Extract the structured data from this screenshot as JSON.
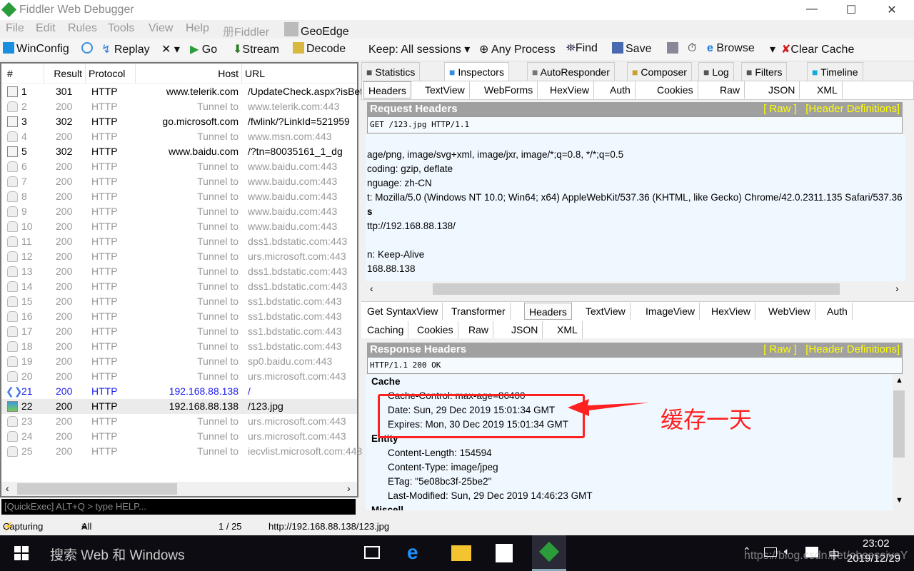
{
  "window": {
    "title": "Fiddler Web Debugger",
    "min": "—",
    "max": "☐",
    "close": "✕"
  },
  "menu": [
    "File",
    "Edit",
    "Rules",
    "Tools",
    "View",
    "Help",
    "Fiddler",
    "GeoEdge"
  ],
  "toolbar": {
    "winconfig": "WinConfig",
    "replay": "Replay",
    "remove": "✕ ▾",
    "go": "Go",
    "stream": "Stream",
    "decode": "Decode",
    "keep": "Keep: All sessions ▾",
    "process": "Any Process",
    "find": "Find",
    "save": "Save",
    "browse": "Browse",
    "browse_arrow": "▾",
    "clear_cache": "Clear Cache"
  },
  "sessions": {
    "columns": [
      "#",
      "Result",
      "Protocol",
      "Host",
      "URL"
    ],
    "rows": [
      {
        "id": "1",
        "result": "301",
        "protocol": "HTTP",
        "host": "www.telerik.com",
        "url": "/UpdateCheck.aspx?isBet",
        "type": "redirect"
      },
      {
        "id": "2",
        "result": "200",
        "protocol": "HTTP",
        "host": "Tunnel to",
        "url": "www.telerik.com:443",
        "type": "tunnel"
      },
      {
        "id": "3",
        "result": "302",
        "protocol": "HTTP",
        "host": "go.microsoft.com",
        "url": "/fwlink/?LinkId=521959",
        "type": "redirect"
      },
      {
        "id": "4",
        "result": "200",
        "protocol": "HTTP",
        "host": "Tunnel to",
        "url": "www.msn.com:443",
        "type": "tunnel"
      },
      {
        "id": "5",
        "result": "302",
        "protocol": "HTTP",
        "host": "www.baidu.com",
        "url": "/?tn=80035161_1_dg",
        "type": "redirect"
      },
      {
        "id": "6",
        "result": "200",
        "protocol": "HTTP",
        "host": "Tunnel to",
        "url": "www.baidu.com:443",
        "type": "tunnel"
      },
      {
        "id": "7",
        "result": "200",
        "protocol": "HTTP",
        "host": "Tunnel to",
        "url": "www.baidu.com:443",
        "type": "tunnel"
      },
      {
        "id": "8",
        "result": "200",
        "protocol": "HTTP",
        "host": "Tunnel to",
        "url": "www.baidu.com:443",
        "type": "tunnel"
      },
      {
        "id": "9",
        "result": "200",
        "protocol": "HTTP",
        "host": "Tunnel to",
        "url": "www.baidu.com:443",
        "type": "tunnel"
      },
      {
        "id": "10",
        "result": "200",
        "protocol": "HTTP",
        "host": "Tunnel to",
        "url": "www.baidu.com:443",
        "type": "tunnel"
      },
      {
        "id": "11",
        "result": "200",
        "protocol": "HTTP",
        "host": "Tunnel to",
        "url": "dss1.bdstatic.com:443",
        "type": "tunnel"
      },
      {
        "id": "12",
        "result": "200",
        "protocol": "HTTP",
        "host": "Tunnel to",
        "url": "urs.microsoft.com:443",
        "type": "tunnel"
      },
      {
        "id": "13",
        "result": "200",
        "protocol": "HTTP",
        "host": "Tunnel to",
        "url": "dss1.bdstatic.com:443",
        "type": "tunnel"
      },
      {
        "id": "14",
        "result": "200",
        "protocol": "HTTP",
        "host": "Tunnel to",
        "url": "dss1.bdstatic.com:443",
        "type": "tunnel"
      },
      {
        "id": "15",
        "result": "200",
        "protocol": "HTTP",
        "host": "Tunnel to",
        "url": "ss1.bdstatic.com:443",
        "type": "tunnel"
      },
      {
        "id": "16",
        "result": "200",
        "protocol": "HTTP",
        "host": "Tunnel to",
        "url": "ss1.bdstatic.com:443",
        "type": "tunnel"
      },
      {
        "id": "17",
        "result": "200",
        "protocol": "HTTP",
        "host": "Tunnel to",
        "url": "ss1.bdstatic.com:443",
        "type": "tunnel"
      },
      {
        "id": "18",
        "result": "200",
        "protocol": "HTTP",
        "host": "Tunnel to",
        "url": "ss1.bdstatic.com:443",
        "type": "tunnel"
      },
      {
        "id": "19",
        "result": "200",
        "protocol": "HTTP",
        "host": "Tunnel to",
        "url": "sp0.baidu.com:443",
        "type": "tunnel"
      },
      {
        "id": "20",
        "result": "200",
        "protocol": "HTTP",
        "host": "Tunnel to",
        "url": "urs.microsoft.com:443",
        "type": "tunnel"
      },
      {
        "id": "21",
        "result": "200",
        "protocol": "HTTP",
        "host": "192.168.88.138",
        "url": "/",
        "type": "html"
      },
      {
        "id": "22",
        "result": "200",
        "protocol": "HTTP",
        "host": "192.168.88.138",
        "url": "/123.jpg",
        "type": "image",
        "selected": true
      },
      {
        "id": "23",
        "result": "200",
        "protocol": "HTTP",
        "host": "Tunnel to",
        "url": "urs.microsoft.com:443",
        "type": "tunnel"
      },
      {
        "id": "24",
        "result": "200",
        "protocol": "HTTP",
        "host": "Tunnel to",
        "url": "urs.microsoft.com:443",
        "type": "tunnel"
      },
      {
        "id": "25",
        "result": "200",
        "protocol": "HTTP",
        "host": "Tunnel to",
        "url": "iecvlist.microsoft.com:443",
        "type": "tunnel"
      }
    ]
  },
  "quickexec": {
    "placeholder": "[QuickExec] ALT+Q > type HELP..."
  },
  "status": {
    "capturing": "Capturing",
    "processes": "All Processes",
    "count": "1 / 25",
    "url": "http://192.168.88.138/123.jpg"
  },
  "tabs": [
    "Statistics",
    "Inspectors",
    "AutoResponder",
    "Composer",
    "Log",
    "Filters",
    "Timeline"
  ],
  "request_tabs": [
    "Headers",
    "TextView",
    "WebForms",
    "HexView",
    "Auth",
    "Cookies",
    "Raw",
    "JSON",
    "XML"
  ],
  "request": {
    "title": "Request Headers",
    "raw": "[ Raw ]",
    "defs": "[Header Definitions]",
    "first_line": "GET /123.jpg HTTP/1.1",
    "lines": [
      {
        "t": "",
        "b": false
      },
      {
        "t": "age/png, image/svg+xml, image/jxr, image/*;q=0.8, */*;q=0.5",
        "b": false
      },
      {
        "t": "coding: gzip, deflate",
        "b": false
      },
      {
        "t": "nguage: zh-CN",
        "b": false
      },
      {
        "t": "t: Mozilla/5.0 (Windows NT 10.0; Win64; x64) AppleWebKit/537.36 (KHTML, like Gecko) Chrome/42.0.2311.135 Safari/537.36",
        "b": false
      },
      {
        "t": "s",
        "b": true
      },
      {
        "t": "ttp://192.168.88.138/",
        "b": false
      },
      {
        "t": "",
        "b": false
      },
      {
        "t": "n: Keep-Alive",
        "b": false
      },
      {
        "t": "168.88.138",
        "b": false
      }
    ]
  },
  "response_tabs_row1": [
    "Get SyntaxView",
    "Transformer",
    "Headers",
    "TextView",
    "ImageView",
    "HexView",
    "WebView",
    "Auth"
  ],
  "response_tabs_row2": [
    "Caching",
    "Cookies",
    "Raw",
    "JSON",
    "XML"
  ],
  "response": {
    "title": "Response Headers",
    "raw": "[ Raw ]",
    "defs": "[Header Definitions]",
    "first_line": "HTTP/1.1 200 OK",
    "lines": [
      {
        "t": "Cache",
        "b": true
      },
      {
        "t": "Cache-Control: max-age=86400",
        "b": false
      },
      {
        "t": "Date: Sun, 29 Dec 2019 15:01:34 GMT",
        "b": false
      },
      {
        "t": "Expires: Mon, 30 Dec 2019 15:01:34 GMT",
        "b": false
      },
      {
        "t": "Entity",
        "b": true
      },
      {
        "t": "Content-Length: 154594",
        "b": false
      },
      {
        "t": "Content-Type: image/jpeg",
        "b": false
      },
      {
        "t": "ETag: \"5e08bc3f-25be2\"",
        "b": false
      },
      {
        "t": "Last-Modified: Sun, 29 Dec 2019 14:46:23 GMT",
        "b": false
      },
      {
        "t": "Miscell",
        "b": true
      }
    ]
  },
  "annotation": {
    "text": "缓存一天",
    "color": "#ff2020"
  },
  "taskbar": {
    "search": "搜索 Web 和 Windows",
    "time": "23:02",
    "date": "2019/12/29",
    "ime": "中",
    "watermark": "https://blog.csdn.net/obsessiveY"
  }
}
